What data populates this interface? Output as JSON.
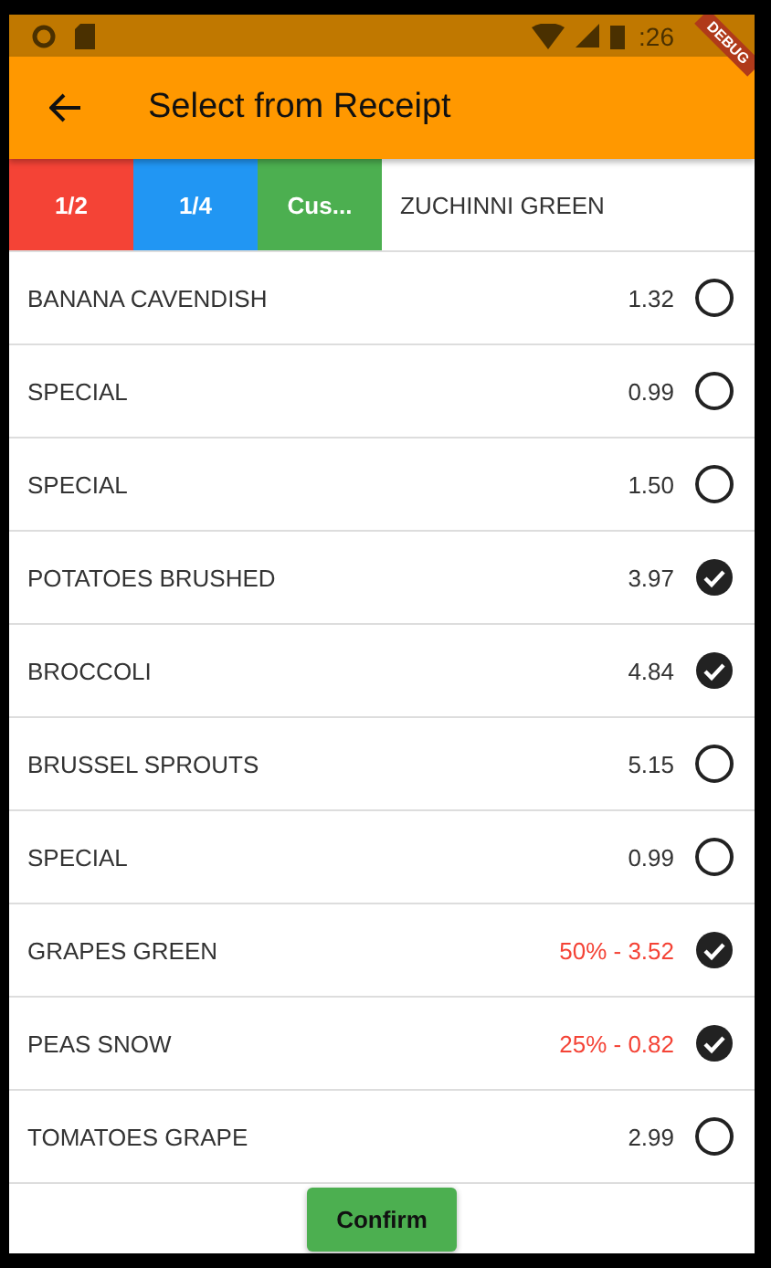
{
  "status_bar": {
    "time": ":26"
  },
  "debug_banner": "DEBUG",
  "app_bar": {
    "title": "Select from Receipt"
  },
  "split_tabs": [
    {
      "label": "1/2",
      "color": "#f44336"
    },
    {
      "label": "1/4",
      "color": "#2196f3"
    },
    {
      "label": "Cus...",
      "color": "#4caf50"
    }
  ],
  "current_item": "ZUCHINNI GREEN",
  "items": [
    {
      "name": "BANANA CAVENDISH",
      "price": "1.32",
      "discounted": false,
      "checked": false
    },
    {
      "name": "SPECIAL",
      "price": "0.99",
      "discounted": false,
      "checked": false
    },
    {
      "name": "SPECIAL",
      "price": "1.50",
      "discounted": false,
      "checked": false
    },
    {
      "name": "POTATOES BRUSHED",
      "price": "3.97",
      "discounted": false,
      "checked": true
    },
    {
      "name": "BROCCOLI",
      "price": "4.84",
      "discounted": false,
      "checked": true
    },
    {
      "name": "BRUSSEL SPROUTS",
      "price": "5.15",
      "discounted": false,
      "checked": false
    },
    {
      "name": "SPECIAL",
      "price": "0.99",
      "discounted": false,
      "checked": false
    },
    {
      "name": "GRAPES GREEN",
      "price": "50% - 3.52",
      "discounted": true,
      "checked": true
    },
    {
      "name": "PEAS SNOW",
      "price": "25% - 0.82",
      "discounted": true,
      "checked": true
    },
    {
      "name": "TOMATOES GRAPE",
      "price": "2.99",
      "discounted": false,
      "checked": false
    }
  ],
  "confirm_button": "Confirm"
}
